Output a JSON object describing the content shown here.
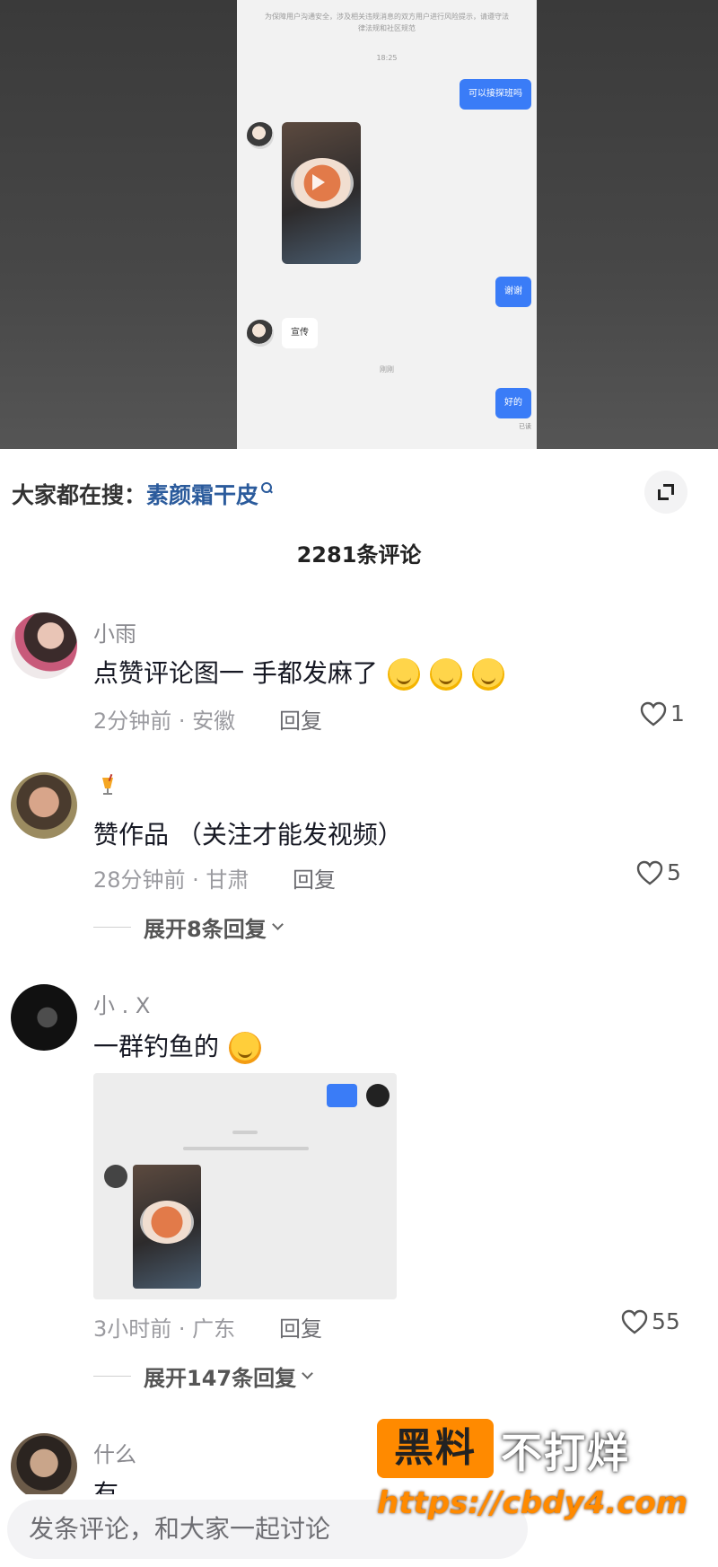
{
  "video": {
    "system_notice": "为保障用户沟通安全，涉及相关违规消息的双方用户进行风险提示，请遵守法律法规和社区规范",
    "time": "18:25",
    "msg_out_1": "可以接探班吗",
    "msg_out_2": "谢谢",
    "msg_in_1": "宣传",
    "status_line": "刚刚",
    "msg_out_3": "好的",
    "read_tag": "已读"
  },
  "search": {
    "prefix": "大家都在搜：",
    "term": "素颜霜干皮"
  },
  "comment_count": "2281条评论",
  "comments": [
    {
      "username": "小雨",
      "text": "点赞评论图一 手都发麻了",
      "time_location": "2分钟前 · 安徽",
      "reply_label": "回复",
      "likes": "1"
    },
    {
      "username": "",
      "text": "赞作品 （关注才能发视频）",
      "time_location": "28分钟前 · 甘肃",
      "reply_label": "回复",
      "likes": "5",
      "expand_label": "展开8条回复"
    },
    {
      "username": "小 . X",
      "text": "一群钓鱼的",
      "time_location": "3小时前 · 广东",
      "reply_label": "回复",
      "likes": "55",
      "expand_label": "展开147条回复"
    },
    {
      "username": "什么",
      "text": "有"
    }
  ],
  "input": {
    "placeholder": "发条评论，和大家一起讨论"
  },
  "watermark": {
    "badge": "黑料",
    "text": "不打烊",
    "url": "https://cbdy4.com"
  },
  "colors": {
    "accent_blue": "#3a7cf7",
    "search_term": "#2b5b9c",
    "watermark_orange": "#ff8a00"
  }
}
